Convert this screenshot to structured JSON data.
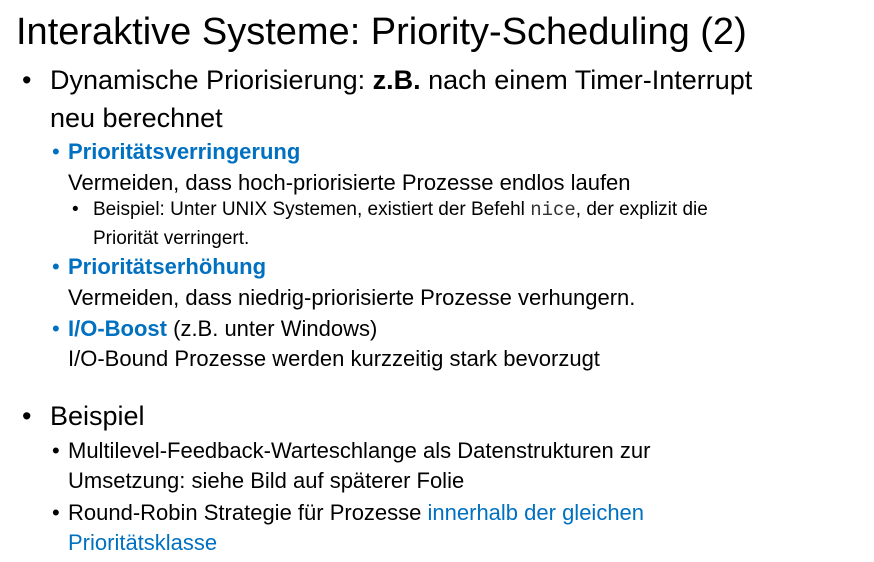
{
  "title": "Interaktive Systeme: Priority-Scheduling (2)",
  "bullet": "•",
  "items": {
    "dyn_line1_a": "Dynamische Priorisierung: ",
    "dyn_line1_b": "z.B.",
    "dyn_line1_c": " nach einem Timer-Interrupt",
    "dyn_line2": "neu berechnet",
    "verr_head": "Prioritätsverringerung",
    "verr_text": "Vermeiden, dass hoch-priorisierte Prozesse endlos laufen",
    "bsp_a": "Beispiel:  Unter UNIX Systemen, existiert der Befehl ",
    "bsp_code": "nice",
    "bsp_b": ", der explizit die",
    "bsp_line2": "Priorität verringert.",
    "erh_head": "Prioritätserhöhung",
    "erh_text": "Vermeiden, dass niedrig-priorisierte Prozesse verhungern.",
    "io_head": "I/O-Boost",
    "io_head_rest": " (z.B. unter Windows)",
    "io_text": "I/O-Bound Prozesse werden kurzzeitig stark bevorzugt",
    "beispiel": "Beispiel",
    "mlf_line1": "Multilevel-Feedback-Warteschlange als Datenstrukturen zur",
    "mlf_line2": "Umsetzung: siehe Bild auf späterer Folie",
    "rr_a": "Round-Robin Strategie für Prozesse ",
    "rr_b": "innerhalb der gleichen",
    "rr_line2": "Prioritätsklasse"
  },
  "colors": {
    "accent": "#0070C0"
  }
}
